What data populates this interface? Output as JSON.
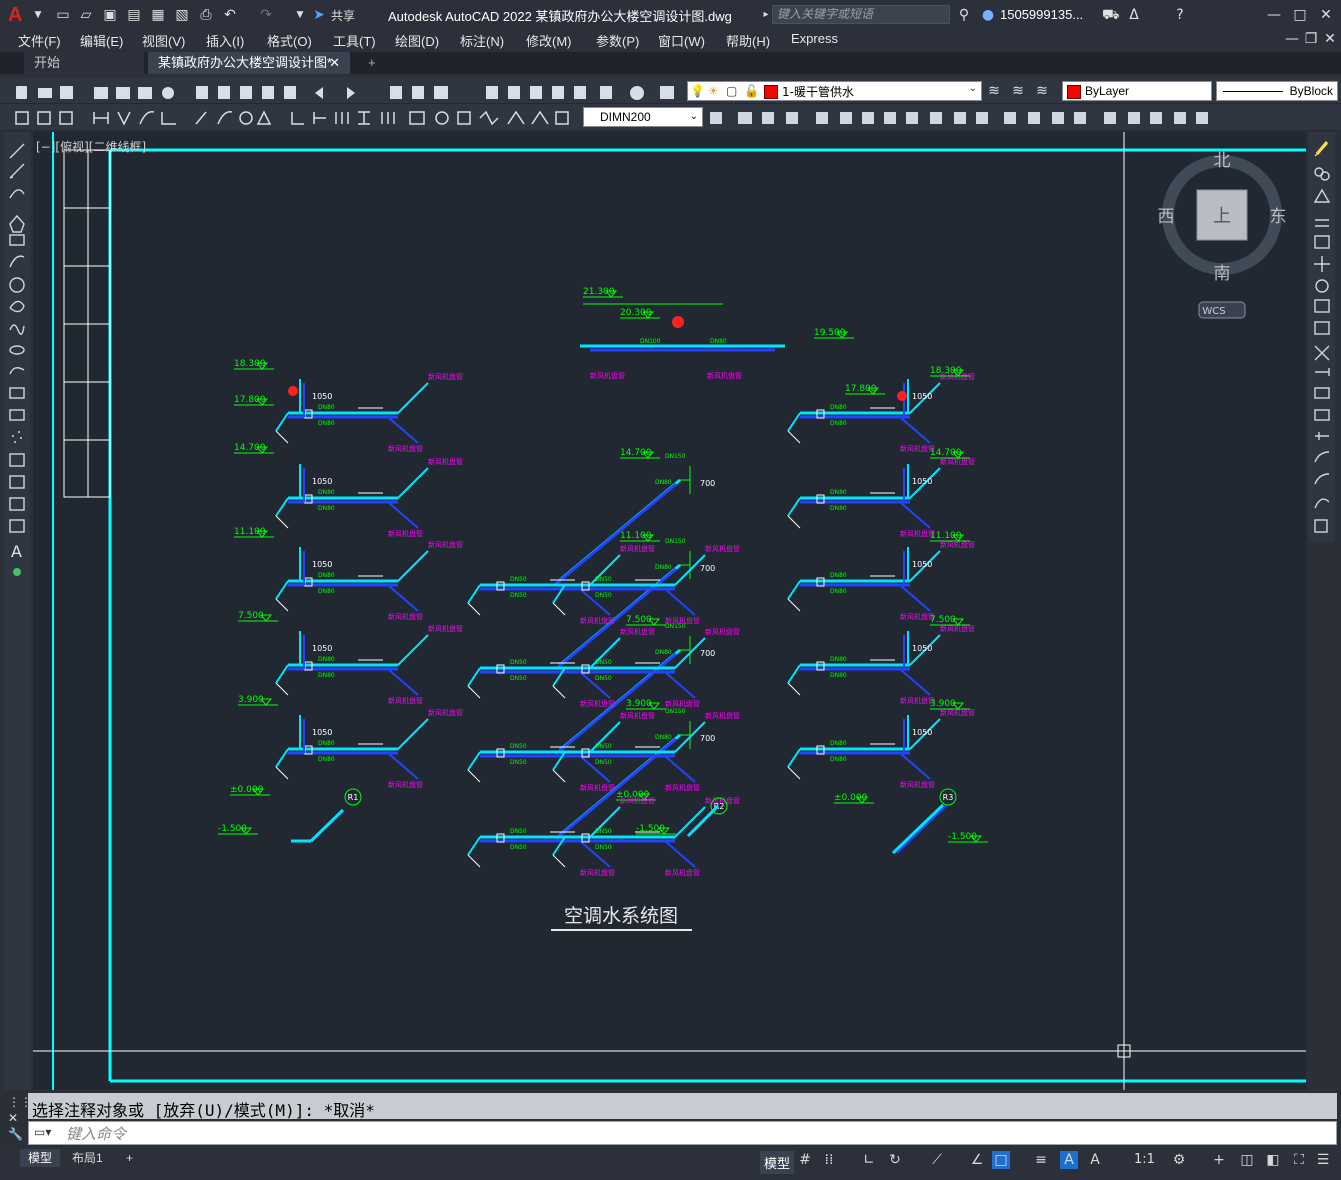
{
  "app": {
    "logo": "A",
    "title": "Autodesk AutoCAD 2022    某镇政府办公大楼空调设计图.dwg",
    "share_label": "共享",
    "search_placeholder": "键入关键字或短语",
    "user": "1505999135..."
  },
  "menu": [
    "文件(F)",
    "编辑(E)",
    "视图(V)",
    "插入(I)",
    "格式(O)",
    "工具(T)",
    "绘图(D)",
    "标注(N)",
    "修改(M)",
    "参数(P)",
    "窗口(W)",
    "帮助(H)",
    "Express"
  ],
  "tabs": {
    "start": "开始",
    "drawing": "某镇政府办公大楼空调设计图*",
    "add": "+"
  },
  "layer": {
    "current": "1-暖干管供水",
    "color": "#ff0000"
  },
  "color_control": "ByLayer",
  "linetype_control": "ByBlock",
  "dim_style": "DIMN200",
  "viewport_label": "[−][俯视][二维线框]",
  "viewcube": {
    "north": "北",
    "south": "南",
    "east": "东",
    "west": "西",
    "face": "上",
    "wcs": "WCS"
  },
  "drawing": {
    "title": "空调水系统图",
    "riser_labels": [
      "R1",
      "R2",
      "R3"
    ],
    "equipment_label": "新风机盘管",
    "elevations": {
      "left": [
        "18.300",
        "17.800",
        "14.700",
        "11.100",
        "7.500",
        "3.900",
        "±0.000",
        "-1.500"
      ],
      "center": [
        "21.300",
        "20.300",
        "19.500",
        "14.700",
        "11.100",
        "7.500",
        "3.900",
        "±0.000",
        "-1.500"
      ],
      "right": [
        "18.300",
        "17.800",
        "14.700",
        "11.100",
        "7.500",
        "3.900",
        "±0.000",
        "-1.500"
      ]
    },
    "dims": {
      "riser": "1050",
      "riser_center": "700"
    },
    "pipe_sizes": {
      "main": "DN80",
      "top": "DN100",
      "branch": "DN50",
      "riser": "DN125",
      "riser2": "DN150"
    }
  },
  "command": {
    "history": "选择注释对象或 [放弃(U)/模式(M)]: *取消*",
    "placeholder": "键入命令"
  },
  "status": {
    "model_tab": "模型",
    "layout_tab": "布局1",
    "add": "+",
    "model_button": "模型",
    "scale": "1:1"
  },
  "colors": {
    "canvas": "#212832",
    "border": "#00ffff",
    "pipe_supply": "#00e5ff",
    "pipe_return": "#2244ff",
    "dim_green": "#00ff00",
    "label_magenta": "#ff00ff",
    "valve_red": "#ff2020"
  }
}
